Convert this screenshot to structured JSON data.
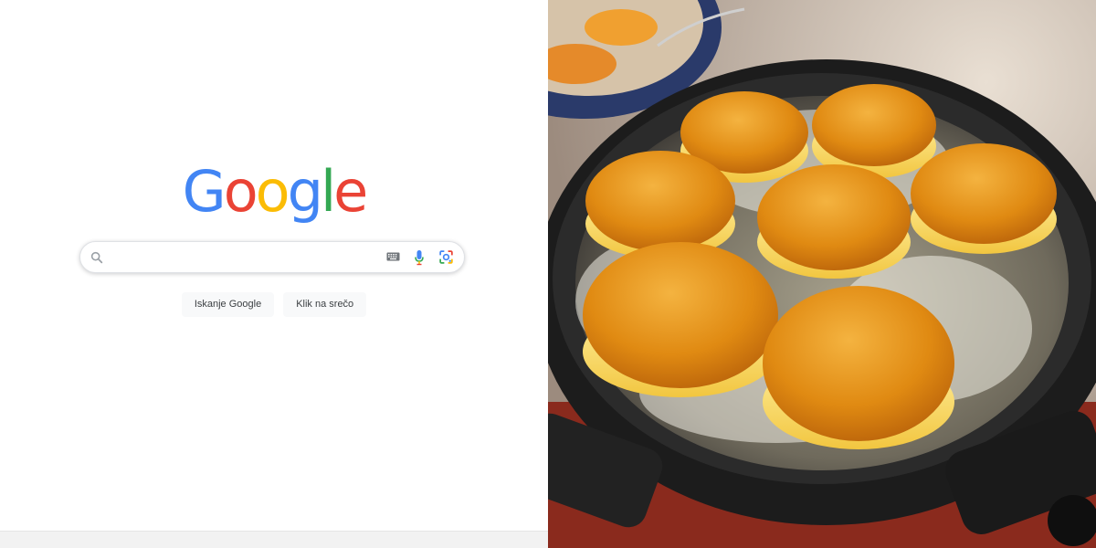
{
  "logo": {
    "letters": [
      "G",
      "o",
      "o",
      "g",
      "l",
      "e"
    ],
    "colors": [
      "#4285F4",
      "#EA4335",
      "#FBBC05",
      "#4285F4",
      "#34A853",
      "#EA4335"
    ]
  },
  "search": {
    "value": "",
    "icons": [
      "search-icon",
      "keyboard-icon",
      "mic-icon",
      "lens-icon"
    ]
  },
  "buttons": {
    "search_label": "Iskanje Google",
    "lucky_label": "Klik na srečo"
  },
  "photo": {
    "subject": "doughnuts frying in oil in an electric pan"
  }
}
